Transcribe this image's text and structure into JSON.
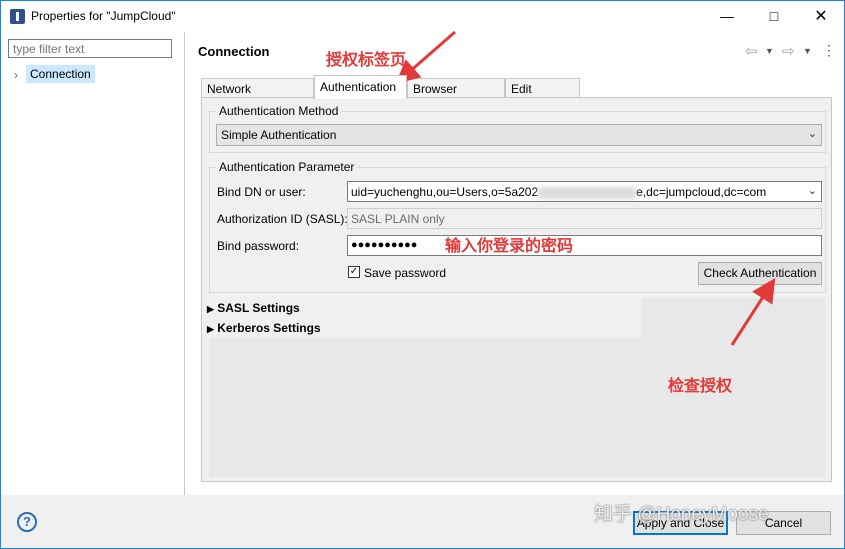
{
  "window": {
    "title": "Properties for \"JumpCloud\""
  },
  "sidebar": {
    "filter_placeholder": "type filter text",
    "items": [
      {
        "label": "Connection"
      }
    ]
  },
  "page": {
    "title": "Connection"
  },
  "tabs": [
    {
      "label": "Network Parameter"
    },
    {
      "label": "Authentication"
    },
    {
      "label": "Browser Options"
    },
    {
      "label": "Edit Options"
    }
  ],
  "auth_method": {
    "group_label": "Authentication Method",
    "selected": "Simple Authentication"
  },
  "auth_params": {
    "group_label": "Authentication Parameter",
    "bind_dn_label": "Bind DN or user:",
    "bind_dn_prefix": "uid=yuchenghu,ou=Users,o=5a202",
    "bind_dn_suffix": "e,dc=jumpcloud,dc=com",
    "authz_label": "Authorization ID (SASL):",
    "authz_value": "SASL PLAIN only",
    "password_label": "Bind password:",
    "password_value": "●●●●●●●●●●",
    "save_password_label": "Save password",
    "save_password_checked": true,
    "check_button": "Check Authentication"
  },
  "sections": [
    {
      "label": "SASL Settings"
    },
    {
      "label": "Kerberos Settings"
    }
  ],
  "footer": {
    "apply_close": "Apply and Close",
    "cancel": "Cancel"
  },
  "annotations": {
    "tab_note": "授权标签页",
    "password_note": "输入你登录的密码",
    "check_note": "检查授权"
  },
  "watermark": "知乎 @HoneyMoose",
  "colors": {
    "annotation": "#e23a3a",
    "selection": "#cce8ff",
    "accent": "#0078d7"
  }
}
